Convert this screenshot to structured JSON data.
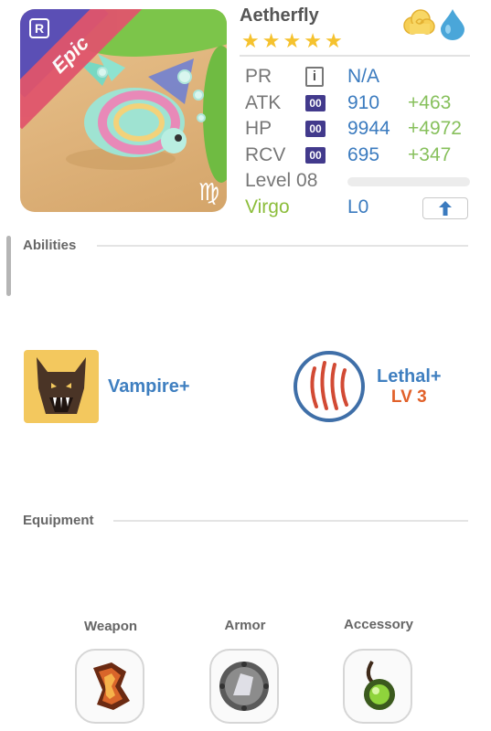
{
  "monster": {
    "name": "Aetherfly",
    "rarity": "Epic",
    "rank_badge": "R",
    "stars": 5,
    "elements": [
      "cloud-icon",
      "water-drop-icon"
    ],
    "zodiac_glyph": "♍"
  },
  "stats": {
    "pr": {
      "label": "PR",
      "value": "N/A"
    },
    "atk": {
      "label": "ATK",
      "badge": "00",
      "value": "910",
      "bonus": "+463"
    },
    "hp": {
      "label": "HP",
      "badge": "00",
      "value": "9944",
      "bonus": "+4972"
    },
    "rcv": {
      "label": "RCV",
      "badge": "00",
      "value": "695",
      "bonus": "+347"
    },
    "level": {
      "label": "Level 08",
      "progress": 0.0
    },
    "sign": {
      "label": "Virgo",
      "value": "L0"
    }
  },
  "sections": {
    "abilities": "Abilities",
    "equipment": "Equipment"
  },
  "abilities": [
    {
      "name": "Vampire+",
      "icon": "werewolf-icon"
    },
    {
      "name": "Lethal+",
      "level": "LV 3",
      "icon": "claw-marks-icon"
    }
  ],
  "equipment": [
    {
      "label": "Weapon",
      "icon": "flame-gauntlet-icon"
    },
    {
      "label": "Armor",
      "icon": "stone-shield-icon"
    },
    {
      "label": "Accessory",
      "icon": "green-orb-icon"
    }
  ],
  "colors": {
    "rarity_ribbon": "#e0556c",
    "stat_value": "#3b7bbf",
    "stat_bonus": "#87c05c",
    "ability_name": "#3f7fc0",
    "ability_level": "#e1612a"
  }
}
